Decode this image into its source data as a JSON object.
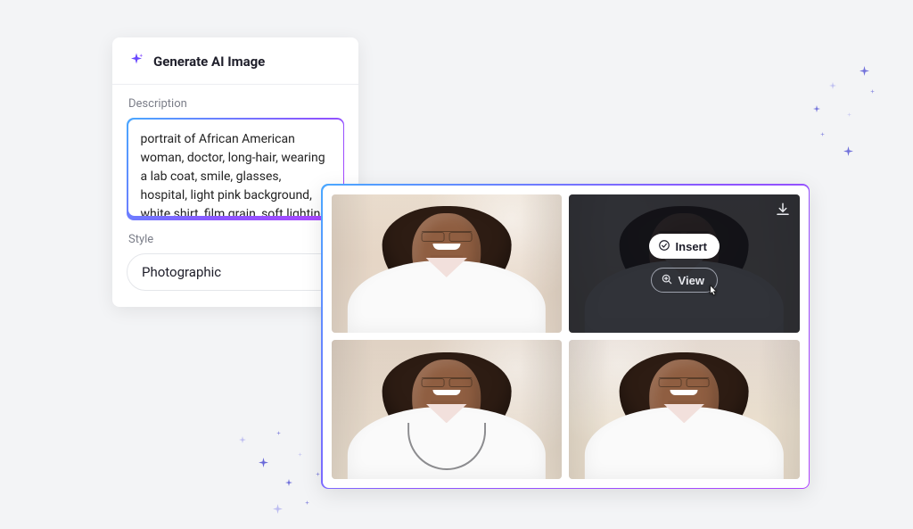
{
  "generator": {
    "title": "Generate AI Image",
    "description_label": "Description",
    "description_value": "portrait of African American woman, doctor, long-hair, wearing a lab coat, smile, glasses, hospital, light pink background, white shirt, film grain, soft lighting",
    "style_label": "Style",
    "style_value": "Photographic"
  },
  "results": {
    "insert_label": "Insert",
    "view_label": "View"
  },
  "icons": {
    "sparkle": "sparkle-icon",
    "download": "download-icon",
    "check_circle": "check-circle-icon",
    "zoom": "zoom-in-icon",
    "cursor": "cursor-icon"
  }
}
